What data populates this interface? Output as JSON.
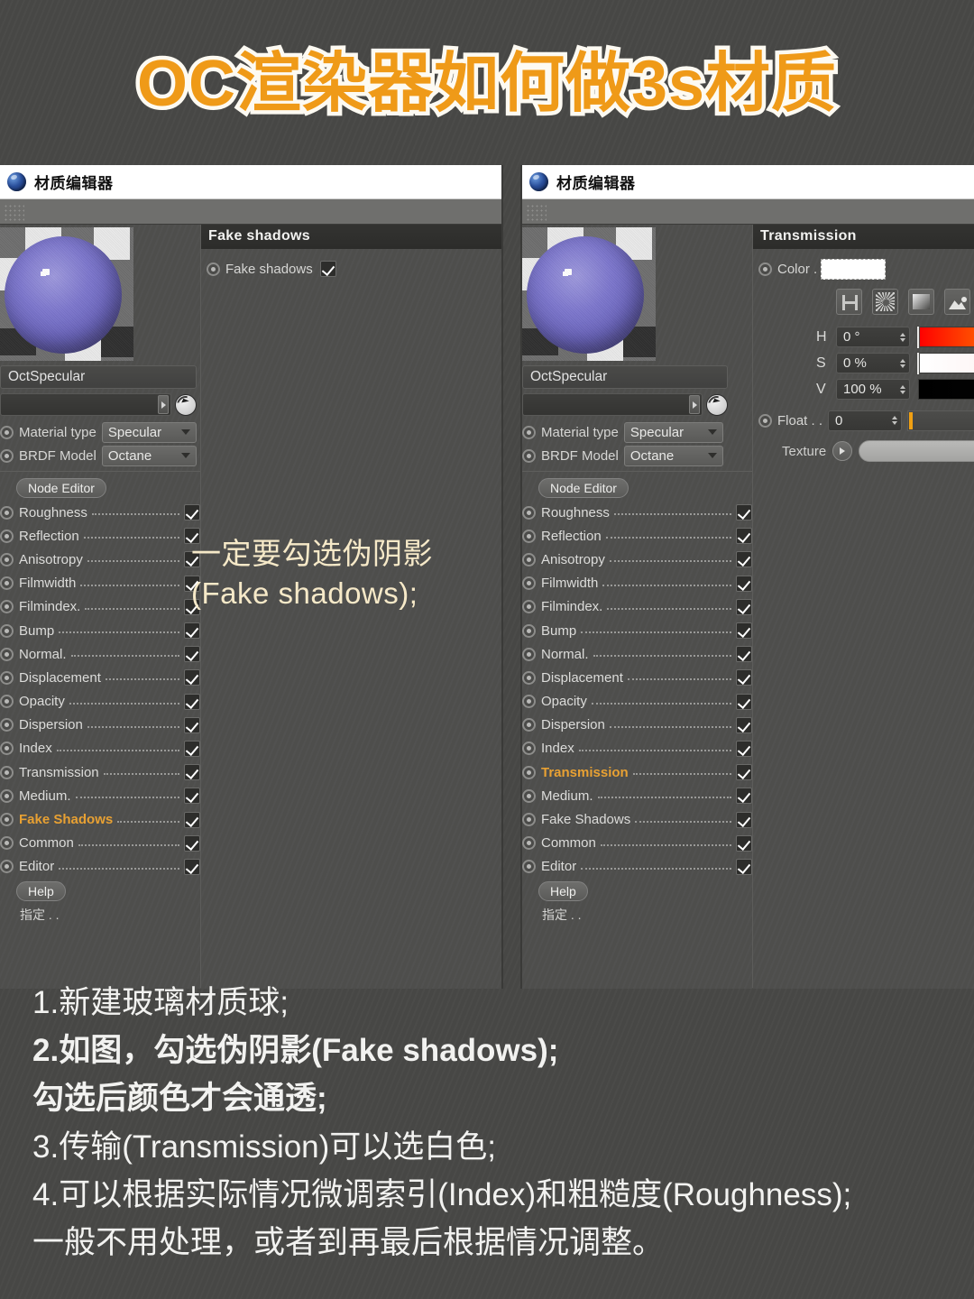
{
  "headline": "OC渲染器如何做3s材质",
  "annotation": "一定要勾选伪阴影\n(Fake shadows);",
  "colors": {
    "accent_orange": "#e8a133",
    "headline_orange": "#ef9a18",
    "headline_outline": "#fdfaf2",
    "annotation_cream": "#f6e9c8",
    "background": "#474745",
    "panel": "#4e4e4c",
    "sphere_purple": "#6a64bd"
  },
  "left_panel": {
    "titlebar": {
      "icon": "octane-app-icon",
      "title": "材质编辑器"
    },
    "material_name": "OctSpecular",
    "link_field_value": "",
    "properties": [
      {
        "label": "Material type",
        "value": "Specular"
      },
      {
        "label": "BRDF Model",
        "value": "Octane"
      }
    ],
    "node_editor_button": "Node Editor",
    "channels": [
      {
        "label": "Roughness",
        "checked": true,
        "active": false
      },
      {
        "label": "Reflection",
        "checked": true,
        "active": false
      },
      {
        "label": "Anisotropy",
        "checked": true,
        "active": false
      },
      {
        "label": "Filmwidth",
        "checked": true,
        "active": false
      },
      {
        "label": "Filmindex.",
        "checked": true,
        "active": false
      },
      {
        "label": "Bump",
        "checked": true,
        "active": false
      },
      {
        "label": "Normal.",
        "checked": true,
        "active": false
      },
      {
        "label": "Displacement",
        "checked": true,
        "active": false
      },
      {
        "label": "Opacity",
        "checked": true,
        "active": false
      },
      {
        "label": "Dispersion",
        "checked": true,
        "active": false
      },
      {
        "label": "Index",
        "checked": true,
        "active": false
      },
      {
        "label": "Transmission",
        "checked": true,
        "active": false
      },
      {
        "label": "Medium.",
        "checked": true,
        "active": false
      },
      {
        "label": "Fake Shadows",
        "checked": true,
        "active": true
      },
      {
        "label": "Common",
        "checked": true,
        "active": false
      },
      {
        "label": "Editor",
        "checked": true,
        "active": false
      }
    ],
    "help_button": "Help",
    "assign_label": "指定 . .",
    "section": {
      "header": "Fake shadows",
      "rows": [
        {
          "label": "Fake shadows",
          "checked": true
        }
      ]
    }
  },
  "right_panel": {
    "titlebar": {
      "icon": "octane-app-icon",
      "title": "材质编辑器"
    },
    "material_name": "OctSpecular",
    "link_field_value": "",
    "properties": [
      {
        "label": "Material type",
        "value": "Specular"
      },
      {
        "label": "BRDF Model",
        "value": "Octane"
      }
    ],
    "node_editor_button": "Node Editor",
    "channels": [
      {
        "label": "Roughness",
        "checked": true,
        "active": false
      },
      {
        "label": "Reflection",
        "checked": true,
        "active": false
      },
      {
        "label": "Anisotropy",
        "checked": true,
        "active": false
      },
      {
        "label": "Filmwidth",
        "checked": true,
        "active": false
      },
      {
        "label": "Filmindex.",
        "checked": true,
        "active": false
      },
      {
        "label": "Bump",
        "checked": true,
        "active": false
      },
      {
        "label": "Normal.",
        "checked": true,
        "active": false
      },
      {
        "label": "Displacement",
        "checked": true,
        "active": false
      },
      {
        "label": "Opacity",
        "checked": true,
        "active": false
      },
      {
        "label": "Dispersion",
        "checked": true,
        "active": false
      },
      {
        "label": "Index",
        "checked": true,
        "active": false
      },
      {
        "label": "Transmission",
        "checked": true,
        "active": true
      },
      {
        "label": "Medium.",
        "checked": true,
        "active": false
      },
      {
        "label": "Fake Shadows",
        "checked": true,
        "active": false
      },
      {
        "label": "Common",
        "checked": true,
        "active": false
      },
      {
        "label": "Editor",
        "checked": true,
        "active": false
      }
    ],
    "help_button": "Help",
    "assign_label": "指定 . .",
    "section": {
      "header": "Transmission",
      "color_label": "Color .",
      "color_swatch": "#ffffff",
      "icons": [
        "resize-icon",
        "color-wheel-icon",
        "gradient-icon",
        "image-icon"
      ],
      "hsv": [
        {
          "label": "H",
          "value": "0 °"
        },
        {
          "label": "S",
          "value": "0 %"
        },
        {
          "label": "V",
          "value": "100 %"
        }
      ],
      "float_label": "Float . .",
      "float_value": "0",
      "texture_label": "Texture"
    }
  },
  "caption_lines": [
    {
      "text": "1.新建玻璃材质球;",
      "bold": false
    },
    {
      "text": "2.如图，勾选伪阴影(Fake shadows);",
      "bold": true
    },
    {
      "text": "勾选后颜色才会通透;",
      "bold": true
    },
    {
      "text": "3.传输(Transmission)可以选白色;",
      "bold": false
    },
    {
      "text": "4.可以根据实际情况微调索引(Index)和粗糙度(Roughness);",
      "bold": false
    },
    {
      "text": "一般不用处理，或者到再最后根据情况调整。",
      "bold": false
    }
  ]
}
